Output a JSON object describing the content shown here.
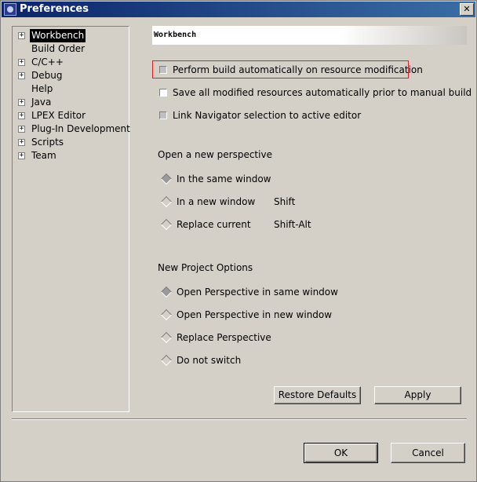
{
  "window": {
    "title": "Preferences"
  },
  "tree": {
    "items": [
      {
        "label": "Workbench",
        "expandable": true,
        "selected": true
      },
      {
        "label": "Build Order",
        "expandable": false
      },
      {
        "label": "C/C++",
        "expandable": true
      },
      {
        "label": "Debug",
        "expandable": true
      },
      {
        "label": "Help",
        "expandable": false
      },
      {
        "label": "Java",
        "expandable": true
      },
      {
        "label": "LPEX Editor",
        "expandable": true
      },
      {
        "label": "Plug-In Development",
        "expandable": true
      },
      {
        "label": "Scripts",
        "expandable": true
      },
      {
        "label": "Team",
        "expandable": true
      }
    ]
  },
  "page": {
    "header": "Workbench",
    "checkboxes": [
      {
        "label": "Perform build automatically on resource modification",
        "checked": false
      },
      {
        "label": "Save all modified resources automatically prior to manual build",
        "checked": false
      },
      {
        "label": "Link Navigator selection to active editor",
        "checked": false
      }
    ],
    "perspective": {
      "title": "Open a new perspective",
      "options": [
        {
          "label": "In the same window",
          "selected": true,
          "shortcut": ""
        },
        {
          "label": "In a new window",
          "selected": false,
          "shortcut": "Shift"
        },
        {
          "label": "Replace current",
          "selected": false,
          "shortcut": "Shift-Alt"
        }
      ]
    },
    "project": {
      "title": "New Project Options",
      "options": [
        {
          "label": "Open Perspective in same window",
          "selected": true
        },
        {
          "label": "Open Perspective in new window",
          "selected": false
        },
        {
          "label": "Replace Perspective",
          "selected": false
        },
        {
          "label": "Do not switch",
          "selected": false
        }
      ]
    },
    "restore_defaults": "Restore Defaults",
    "apply": "Apply"
  },
  "dialog": {
    "ok": "OK",
    "cancel": "Cancel"
  }
}
